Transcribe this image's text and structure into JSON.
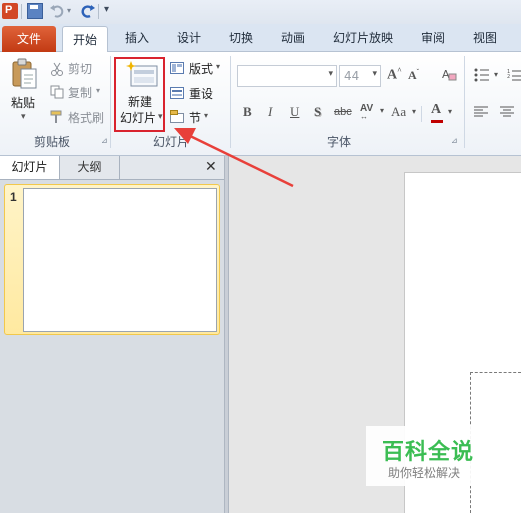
{
  "tabs": {
    "file": "文件",
    "home": "开始",
    "insert": "插入",
    "design": "设计",
    "transitions": "切换",
    "animations": "动画",
    "slideshow": "幻灯片放映",
    "review": "审阅",
    "view": "视图"
  },
  "clipboard": {
    "paste": "粘贴",
    "cut": "剪切",
    "copy": "复制",
    "format_painter": "格式刷",
    "group_label": "剪贴板"
  },
  "slides": {
    "new_slide_line1": "新建",
    "new_slide_line2": "幻灯片",
    "layout": "版式",
    "reset": "重设",
    "section": "节",
    "group_label": "幻灯片"
  },
  "font": {
    "font_name": "",
    "font_size": "44",
    "bold": "B",
    "italic": "I",
    "underline": "U",
    "shadow": "S",
    "strike": "abc",
    "spacing": "AV",
    "case": "Aa",
    "color": "A",
    "grow": "A",
    "shrink": "A",
    "group_label": "字体"
  },
  "panel": {
    "tab_slides": "幻灯片",
    "tab_outline": "大纲",
    "close": "✕",
    "thumb_number": "1"
  },
  "watermark": {
    "title": "百科全说",
    "subtitle": "助你轻松解决"
  },
  "colors": {
    "file_tab": "#d24726",
    "highlight_box": "#d9232e",
    "arrow": "#e8403a",
    "thumb_border": "#f2c84b"
  }
}
